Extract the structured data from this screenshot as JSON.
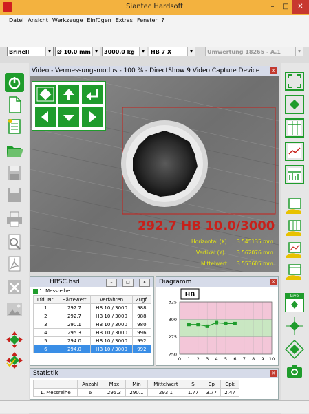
{
  "window": {
    "title": "Siantec Hardsoft",
    "minimize": "–",
    "maximize": "□",
    "close": "✕"
  },
  "menu": [
    "Datei",
    "Ansicht",
    "Werkzeuge",
    "Einfügen",
    "Extras",
    "Fenster",
    "?"
  ],
  "toolbar": {
    "method": "Brinell",
    "diameter": "Ø 10,0 mm",
    "load": "3000.0 kg",
    "scale": "HB 7 X",
    "conversion": "Umwertung 18265 - A.1"
  },
  "video": {
    "title": "Video - Vermessungsmodus - 100 % - DirectShow 9 Video Capture Device",
    "result": "292.7 HB 10.0/3000",
    "measurements": [
      {
        "label": "Horizontal (X)",
        "value": "3.545135 mm"
      },
      {
        "label": "Vertikal (Y)",
        "value": "3.562076 mm"
      },
      {
        "label": "Mittelwert",
        "value": "3.553605 mm"
      }
    ]
  },
  "hbsc": {
    "title": "HBSC.hsd",
    "tab": "1. Messreihe",
    "columns": [
      "Lfd. Nr.",
      "Härtewert",
      "Verfahren",
      "Zugf."
    ],
    "rows": [
      [
        "1",
        "292.7",
        "HB 10 / 3000",
        "988"
      ],
      [
        "2",
        "292.7",
        "HB 10 / 3000",
        "988"
      ],
      [
        "3",
        "290.1",
        "HB 10 / 3000",
        "980"
      ],
      [
        "4",
        "295.3",
        "HB 10 / 3000",
        "996"
      ],
      [
        "5",
        "294.0",
        "HB 10 / 3000",
        "992"
      ],
      [
        "6",
        "294.0",
        "HB 10 / 3000",
        "992"
      ]
    ],
    "selected_row": 5
  },
  "diagram": {
    "title": "Diagramm"
  },
  "chart_data": {
    "type": "line",
    "title": "HB",
    "x": [
      1,
      2,
      3,
      4,
      5,
      6
    ],
    "values": [
      292.7,
      292.7,
      290.1,
      295.3,
      294.0,
      294.0
    ],
    "xlim": [
      0,
      10
    ],
    "ylim": [
      250,
      325
    ],
    "xticks": [
      "0",
      "1",
      "2",
      "3",
      "4",
      "5",
      "6",
      "7",
      "8",
      "9",
      "10"
    ],
    "yticks": [
      "250",
      "275",
      "300",
      "325"
    ],
    "bands": [
      {
        "from": 250,
        "to": 275,
        "color": "#f3c6d8"
      },
      {
        "from": 275,
        "to": 300,
        "color": "#c9e7c2"
      },
      {
        "from": 300,
        "to": 325,
        "color": "#f3c6d8"
      }
    ],
    "line_color": "#1f9c2c"
  },
  "statistik": {
    "title": "Statistik",
    "columns": [
      "",
      "Anzahl",
      "Max",
      "Min",
      "Mittelwert",
      "S",
      "Cp",
      "Cpk"
    ],
    "rows": [
      [
        "1. Messreihe",
        "6",
        "295.3",
        "290.1",
        "293.1",
        "1.77",
        "3.77",
        "2.47"
      ]
    ]
  },
  "colors": {
    "titlebar": "#f3b23f",
    "accent_green": "#1f9c2c",
    "result_red": "#c8201a",
    "meas_yellow": "#e8e810"
  },
  "icons": {
    "nav": [
      "nav-target-icon",
      "arrow-up-icon",
      "enter-icon",
      "arrow-left-icon",
      "arrow-down-icon",
      "arrow-right-icon"
    ],
    "live": "Live"
  }
}
